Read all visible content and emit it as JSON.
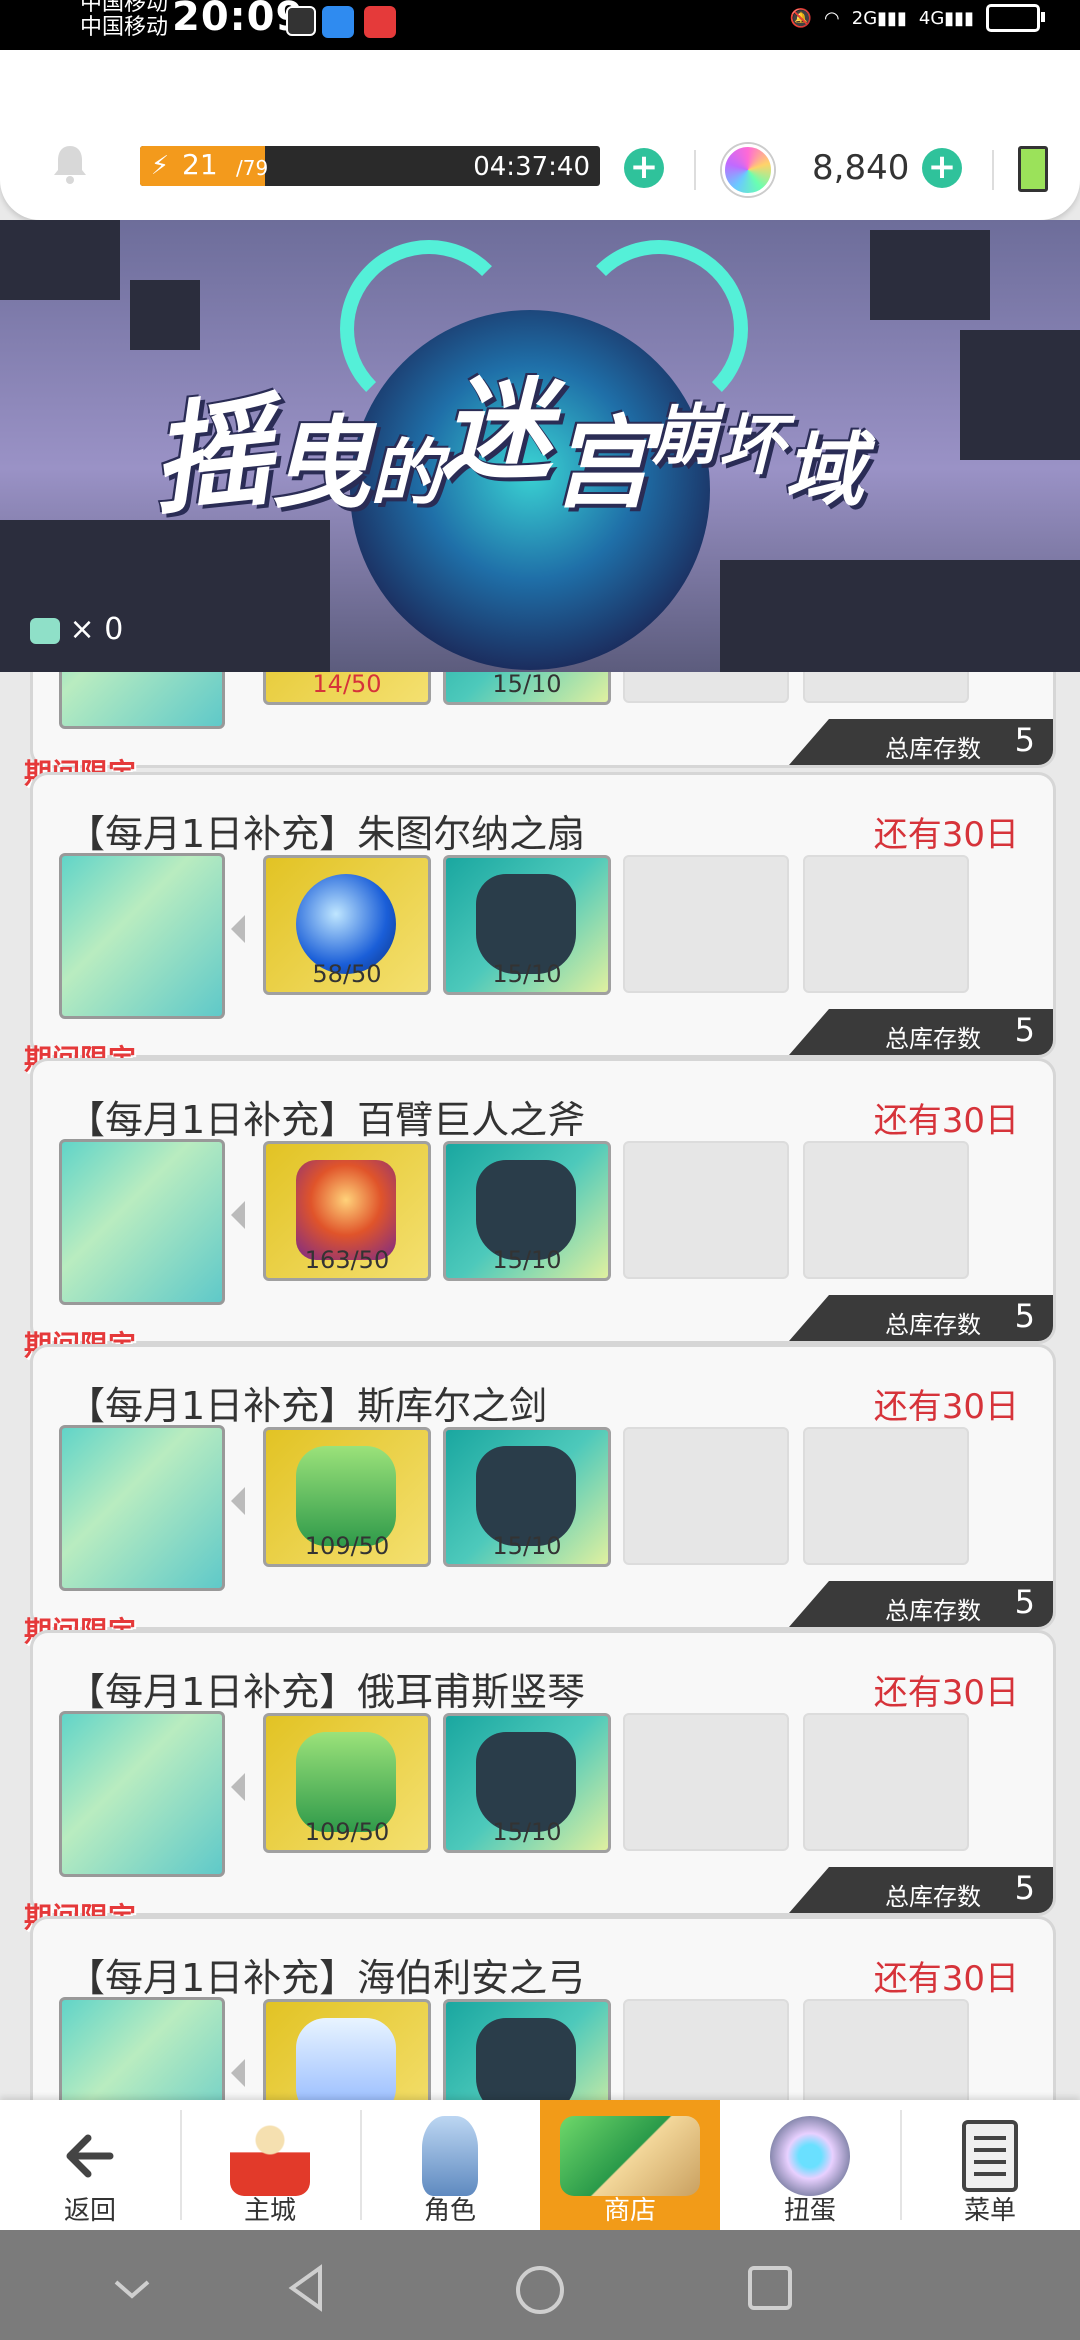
{
  "status_bar": {
    "carrier_1": "中国移动",
    "carrier_2": "中国移动",
    "time": "20:09",
    "net_1": "2G",
    "net_2": "4G"
  },
  "top_bar": {
    "energy_current": "21",
    "energy_max": "/79",
    "energy_timer": "04:37:40",
    "gems": "8,840"
  },
  "banner": {
    "title_chars": [
      "摇",
      "曳",
      "的",
      "迷",
      "宫",
      "崩",
      "坏",
      "域"
    ],
    "ticket_count": "× 0"
  },
  "partial_row": {
    "mat1_count": "14/50",
    "mat2_count": "15/10",
    "stock_label": "总库存数",
    "stock_value": "5"
  },
  "items": [
    {
      "limited": "期间限定",
      "title": "【每月1日补充】朱图尔纳之扇",
      "remain": "还有30日",
      "mat1_count": "58/50",
      "mat2_count": "15/10",
      "stock_label": "总库存数",
      "stock_value": "5"
    },
    {
      "limited": "期间限定",
      "title": "【每月1日补充】百臂巨人之斧",
      "remain": "还有30日",
      "mat1_count": "163/50",
      "mat2_count": "15/10",
      "stock_label": "总库存数",
      "stock_value": "5"
    },
    {
      "limited": "期间限定",
      "title": "【每月1日补充】斯库尔之剑",
      "remain": "还有30日",
      "mat1_count": "109/50",
      "mat2_count": "15/10",
      "stock_label": "总库存数",
      "stock_value": "5"
    },
    {
      "limited": "期间限定",
      "title": "【每月1日补充】俄耳甫斯竖琴",
      "remain": "还有30日",
      "mat1_count": "109/50",
      "mat2_count": "15/10",
      "stock_label": "总库存数",
      "stock_value": "5"
    },
    {
      "limited": "期间限定",
      "title": "【每月1日补充】海伯利安之弓",
      "remain": "还有30日",
      "mat1_count": "",
      "mat2_count": "",
      "stock_label": "",
      "stock_value": ""
    }
  ],
  "tabs": [
    {
      "label": "返回",
      "icon": "back-arrow-icon"
    },
    {
      "label": "主城",
      "icon": "castle-icon"
    },
    {
      "label": "角色",
      "icon": "character-icon"
    },
    {
      "label": "商店",
      "icon": "shop-icon"
    },
    {
      "label": "扭蛋",
      "icon": "gacha-icon"
    },
    {
      "label": "菜单",
      "icon": "menu-icon"
    }
  ],
  "colors": {
    "accent": "#2fc29b",
    "active_tab": "#f29b18",
    "remain_text": "#d6333a",
    "limited_text": "#e5393a"
  }
}
